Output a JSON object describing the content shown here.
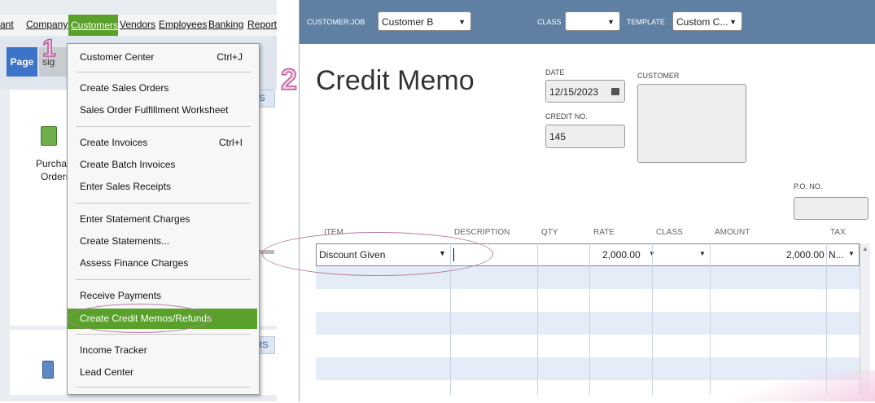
{
  "menubar": {
    "items": [
      "ant",
      "Company",
      "Customers",
      "Vendors",
      "Employees",
      "Banking",
      "Reports"
    ]
  },
  "tabs": {
    "page": "Page",
    "other": "sig"
  },
  "homepage": {
    "purchase_orders_line1": "Purchas",
    "purchase_orders_line2": "Orders",
    "side_button_1": "S",
    "side_button_2": "RS"
  },
  "customers_menu": {
    "items": [
      {
        "label": "Customer Center",
        "shortcut": "Ctrl+J"
      },
      {
        "label": "Create Sales Orders",
        "shortcut": ""
      },
      {
        "label": "Sales Order Fulfillment Worksheet",
        "shortcut": ""
      },
      {
        "label": "Create Invoices",
        "shortcut": "Ctrl+I"
      },
      {
        "label": "Create Batch Invoices",
        "shortcut": ""
      },
      {
        "label": "Enter Sales Receipts",
        "shortcut": ""
      },
      {
        "label": "Enter Statement Charges",
        "shortcut": ""
      },
      {
        "label": "Create Statements...",
        "shortcut": ""
      },
      {
        "label": "Assess Finance Charges",
        "shortcut": ""
      },
      {
        "label": "Receive Payments",
        "shortcut": ""
      },
      {
        "label": "Create Credit Memos/Refunds",
        "shortcut": ""
      },
      {
        "label": "Income Tracker",
        "shortcut": ""
      },
      {
        "label": "Lead Center",
        "shortcut": ""
      }
    ]
  },
  "credit_memo": {
    "toolbar": {
      "customer_job_label": "CUSTOMER:JOB",
      "customer_job_value": "Customer B",
      "class_label": "CLASS",
      "class_value": "",
      "template_label": "TEMPLATE",
      "template_value": "Custom C..."
    },
    "title": "Credit Memo",
    "date_label": "DATE",
    "date_value": "12/15/2023",
    "credit_no_label": "CREDIT NO.",
    "credit_no_value": "145",
    "customer_label": "CUSTOMER",
    "po_label": "P.O. NO.",
    "columns": [
      "ITEM",
      "DESCRIPTION",
      "QTY",
      "RATE",
      "CLASS",
      "AMOUNT",
      "TAX"
    ],
    "line1": {
      "item": "Discount Given",
      "description": "",
      "qty": "",
      "rate": "2,000.00",
      "class": "",
      "amount": "2,000.00",
      "tax": "N..."
    }
  },
  "annotations": {
    "step1": "1",
    "step2": "2"
  },
  "colors": {
    "menu_highlight": "#5aa12b",
    "header_bar": "#5f7fa3",
    "annotation": "#b65b9c"
  }
}
